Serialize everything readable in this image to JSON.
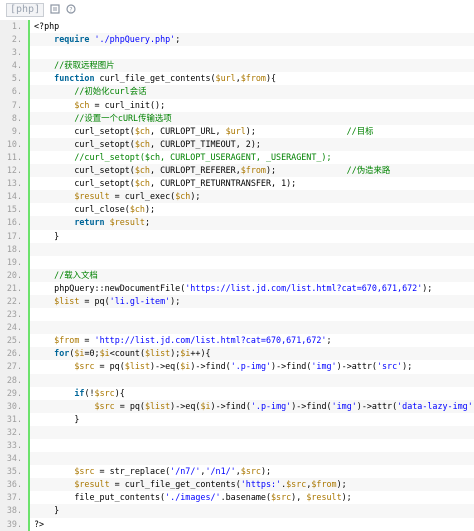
{
  "toolbar": {
    "language_tag": "[php]",
    "view_icon": "copy-icon",
    "help_icon": "help-icon"
  },
  "lines": [
    {
      "n": "1.",
      "tokens": [
        [
          "pl",
          "<?php"
        ]
      ]
    },
    {
      "n": "2.",
      "tokens": [
        [
          "pl",
          "    "
        ],
        [
          "kw",
          "require"
        ],
        [
          "pl",
          " "
        ],
        [
          "str",
          "'./phpQuery.php'"
        ],
        [
          "pl",
          ";"
        ]
      ]
    },
    {
      "n": "3.",
      "tokens": []
    },
    {
      "n": "4.",
      "tokens": [
        [
          "cm",
          "    //获取远程图片"
        ]
      ]
    },
    {
      "n": "5.",
      "tokens": [
        [
          "pl",
          "    "
        ],
        [
          "kw",
          "function"
        ],
        [
          "pl",
          " curl_file_get_contents("
        ],
        [
          "var",
          "$url"
        ],
        [
          "pl",
          ","
        ],
        [
          "var",
          "$from"
        ],
        [
          "pl",
          "){"
        ]
      ]
    },
    {
      "n": "6.",
      "tokens": [
        [
          "cm",
          "        //初始化curl会话"
        ]
      ]
    },
    {
      "n": "7.",
      "tokens": [
        [
          "pl",
          "        "
        ],
        [
          "var",
          "$ch"
        ],
        [
          "pl",
          " = curl_init();"
        ]
      ]
    },
    {
      "n": "8.",
      "tokens": [
        [
          "cm",
          "        //设置一个cURL传输选项"
        ]
      ]
    },
    {
      "n": "9.",
      "tokens": [
        [
          "pl",
          "        curl_setopt("
        ],
        [
          "var",
          "$ch"
        ],
        [
          "pl",
          ", CURLOPT_URL, "
        ],
        [
          "var",
          "$url"
        ],
        [
          "pl",
          ");                  "
        ],
        [
          "cm",
          "//目标"
        ]
      ]
    },
    {
      "n": "10.",
      "tokens": [
        [
          "pl",
          "        curl_setopt("
        ],
        [
          "var",
          "$ch"
        ],
        [
          "pl",
          ", CURLOPT_TIMEOUT, 2);"
        ]
      ]
    },
    {
      "n": "11.",
      "tokens": [
        [
          "cm",
          "        //curl_setopt($ch, CURLOPT_USERAGENT, _USERAGENT_);"
        ]
      ]
    },
    {
      "n": "12.",
      "tokens": [
        [
          "pl",
          "        curl_setopt("
        ],
        [
          "var",
          "$ch"
        ],
        [
          "pl",
          ", CURLOPT_REFERER,"
        ],
        [
          "var",
          "$from"
        ],
        [
          "pl",
          ");              "
        ],
        [
          "cm",
          "//伪造来路"
        ]
      ]
    },
    {
      "n": "13.",
      "tokens": [
        [
          "pl",
          "        curl_setopt("
        ],
        [
          "var",
          "$ch"
        ],
        [
          "pl",
          ", CURLOPT_RETURNTRANSFER, 1);"
        ]
      ]
    },
    {
      "n": "14.",
      "tokens": [
        [
          "pl",
          "        "
        ],
        [
          "var",
          "$result"
        ],
        [
          "pl",
          " = curl_exec("
        ],
        [
          "var",
          "$ch"
        ],
        [
          "pl",
          ");"
        ]
      ]
    },
    {
      "n": "15.",
      "tokens": [
        [
          "pl",
          "        curl_close("
        ],
        [
          "var",
          "$ch"
        ],
        [
          "pl",
          ");"
        ]
      ]
    },
    {
      "n": "16.",
      "tokens": [
        [
          "pl",
          "        "
        ],
        [
          "kw",
          "return"
        ],
        [
          "pl",
          " "
        ],
        [
          "var",
          "$result"
        ],
        [
          "pl",
          ";"
        ]
      ]
    },
    {
      "n": "17.",
      "tokens": [
        [
          "pl",
          "    }"
        ]
      ]
    },
    {
      "n": "18.",
      "tokens": []
    },
    {
      "n": "19.",
      "tokens": []
    },
    {
      "n": "20.",
      "tokens": [
        [
          "cm",
          "    //载入文档"
        ]
      ]
    },
    {
      "n": "21.",
      "tokens": [
        [
          "pl",
          "    phpQuery::newDocumentFile("
        ],
        [
          "str",
          "'https://list.jd.com/list.html?cat=670,671,672'"
        ],
        [
          "pl",
          ");"
        ]
      ]
    },
    {
      "n": "22.",
      "tokens": [
        [
          "pl",
          "    "
        ],
        [
          "var",
          "$list"
        ],
        [
          "pl",
          " = pq("
        ],
        [
          "str",
          "'li.gl-item'"
        ],
        [
          "pl",
          ");"
        ]
      ]
    },
    {
      "n": "23.",
      "tokens": []
    },
    {
      "n": "24.",
      "tokens": []
    },
    {
      "n": "25.",
      "tokens": [
        [
          "pl",
          "    "
        ],
        [
          "var",
          "$from"
        ],
        [
          "pl",
          " = "
        ],
        [
          "str",
          "'http://list.jd.com/list.html?cat=670,671,672'"
        ],
        [
          "pl",
          ";"
        ]
      ]
    },
    {
      "n": "26.",
      "tokens": [
        [
          "pl",
          "    "
        ],
        [
          "kw",
          "for"
        ],
        [
          "pl",
          "("
        ],
        [
          "var",
          "$i"
        ],
        [
          "pl",
          "=0;"
        ],
        [
          "var",
          "$i"
        ],
        [
          "pl",
          "<count("
        ],
        [
          "var",
          "$list"
        ],
        [
          "pl",
          ");"
        ],
        [
          "var",
          "$i"
        ],
        [
          "pl",
          "++){"
        ]
      ]
    },
    {
      "n": "27.",
      "tokens": [
        [
          "pl",
          "        "
        ],
        [
          "var",
          "$src"
        ],
        [
          "pl",
          " = pq("
        ],
        [
          "var",
          "$list"
        ],
        [
          "pl",
          ")->eq("
        ],
        [
          "var",
          "$i"
        ],
        [
          "pl",
          ")->find("
        ],
        [
          "str",
          "'.p-img'"
        ],
        [
          "pl",
          ")->find("
        ],
        [
          "str",
          "'img'"
        ],
        [
          "pl",
          ")->attr("
        ],
        [
          "str",
          "'src'"
        ],
        [
          "pl",
          ");"
        ]
      ]
    },
    {
      "n": "28.",
      "tokens": []
    },
    {
      "n": "29.",
      "tokens": [
        [
          "pl",
          "        "
        ],
        [
          "kw",
          "if"
        ],
        [
          "pl",
          "(!"
        ],
        [
          "var",
          "$src"
        ],
        [
          "pl",
          "){"
        ]
      ]
    },
    {
      "n": "30.",
      "tokens": [
        [
          "pl",
          "            "
        ],
        [
          "var",
          "$src"
        ],
        [
          "pl",
          " = pq("
        ],
        [
          "var",
          "$list"
        ],
        [
          "pl",
          ")->eq("
        ],
        [
          "var",
          "$i"
        ],
        [
          "pl",
          ")->find("
        ],
        [
          "str",
          "'.p-img'"
        ],
        [
          "pl",
          ")->find("
        ],
        [
          "str",
          "'img'"
        ],
        [
          "pl",
          ")->attr("
        ],
        [
          "str",
          "'data-lazy-img'"
        ],
        [
          "pl",
          ");"
        ]
      ]
    },
    {
      "n": "31.",
      "tokens": [
        [
          "pl",
          "        }"
        ]
      ]
    },
    {
      "n": "32.",
      "tokens": []
    },
    {
      "n": "33.",
      "tokens": []
    },
    {
      "n": "34.",
      "tokens": []
    },
    {
      "n": "35.",
      "tokens": [
        [
          "pl",
          "        "
        ],
        [
          "var",
          "$src"
        ],
        [
          "pl",
          " = str_replace("
        ],
        [
          "str",
          "'/n7/'"
        ],
        [
          "pl",
          ","
        ],
        [
          "str",
          "'/n1/'"
        ],
        [
          "pl",
          ","
        ],
        [
          "var",
          "$src"
        ],
        [
          "pl",
          ");"
        ]
      ]
    },
    {
      "n": "36.",
      "tokens": [
        [
          "pl",
          "        "
        ],
        [
          "var",
          "$result"
        ],
        [
          "pl",
          " = curl_file_get_contents("
        ],
        [
          "str",
          "'https:'"
        ],
        [
          "pl",
          "."
        ],
        [
          "var",
          "$src"
        ],
        [
          "pl",
          ","
        ],
        [
          "var",
          "$from"
        ],
        [
          "pl",
          ");"
        ]
      ]
    },
    {
      "n": "37.",
      "tokens": [
        [
          "pl",
          "        file_put_contents("
        ],
        [
          "str",
          "'./images/'"
        ],
        [
          "pl",
          ".basename("
        ],
        [
          "var",
          "$src"
        ],
        [
          "pl",
          "), "
        ],
        [
          "var",
          "$result"
        ],
        [
          "pl",
          ");"
        ]
      ]
    },
    {
      "n": "38.",
      "tokens": [
        [
          "pl",
          "    }"
        ]
      ]
    },
    {
      "n": "39.",
      "tokens": [
        [
          "pl",
          "?>"
        ]
      ]
    }
  ]
}
